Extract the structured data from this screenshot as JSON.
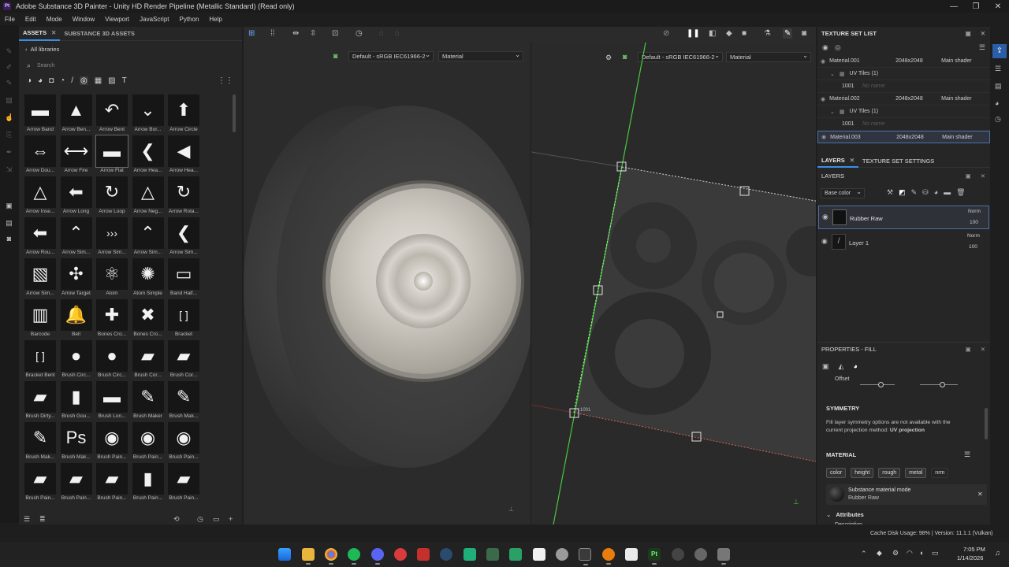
{
  "window": {
    "title": "Adobe Substance 3D Painter - Unity HD Render Pipeline (Metallic Standard) (Read only)",
    "logo_text": "Pt"
  },
  "menu": [
    "File",
    "Edit",
    "Mode",
    "Window",
    "Viewport",
    "JavaScript",
    "Python",
    "Help"
  ],
  "assets": {
    "tabs": [
      "ASSETS",
      "SUBSTANCE 3D ASSETS"
    ],
    "breadcrumb": "All libraries",
    "search_placeholder": "Search",
    "items": [
      "Arrow Band",
      "Arrow Ben...",
      "Arrow Bent",
      "Arrow Bor...",
      "Arrow Circle",
      "Arrow Dou...",
      "Arrow Fire",
      "Arrow Flat",
      "Arrow Hea...",
      "Arrow Hea...",
      "Arrow Inse...",
      "Arrow Long",
      "Arrow Loop",
      "Arrow Neg...",
      "Arrow Rota...",
      "Arrow Rou...",
      "Arrow Sim...",
      "Arrow Sim...",
      "Arrow Sim...",
      "Arrow Sim...",
      "Arrow Sim...",
      "Arrow Target",
      "Atom",
      "Atom Simple",
      "Band Half...",
      "Barcode",
      "Bell",
      "Bones Cro...",
      "Bones Cro...",
      "Bracket",
      "Bracket Bent",
      "Brush Circ...",
      "Brush Circ...",
      "Brush Cor...",
      "Brush Cor...",
      "Brush Dirty...",
      "Brush Gou...",
      "Brush Lon...",
      "Brush Maker",
      "Brush Mak...",
      "Brush Mak...",
      "Brush Mak...",
      "Brush Pain...",
      "Brush Pain...",
      "Brush Pain...",
      "Brush Pain...",
      "Brush Pain...",
      "Brush Pain...",
      "Brush Pain...",
      "Brush Pain..."
    ],
    "glyphs": [
      "▬",
      "▲",
      "↶",
      "⌄",
      "⬆",
      "⇔",
      "⟷",
      "▬",
      "❮",
      "◀",
      "△",
      "⬅",
      "↻",
      "△",
      "↻",
      "⬅",
      "⌃",
      "›››",
      "⌃",
      "❮",
      "▧",
      "✣",
      "⚛",
      "✺",
      "▭",
      "▥",
      "🔔",
      "✚",
      "✖",
      "[ ]",
      "[ ]",
      "●",
      "●",
      "▰",
      "▰",
      "▰",
      "▮",
      "▬",
      "✎",
      "✎",
      "✎",
      "Ps",
      "◉",
      "◉",
      "◉",
      "▰",
      "▰",
      "▰",
      "▮",
      "▰"
    ]
  },
  "viewport": {
    "left": {
      "colorspace": "Default - sRGB IEC61966-2",
      "channel": "Material"
    },
    "right": {
      "colorspace": "Default - sRGB IEC61966-2",
      "channel": "Material"
    },
    "uv_label": "1001"
  },
  "texture_set_list": {
    "title": "TEXTURE SET LIST",
    "sets": [
      {
        "name": "Material.001",
        "res": "2048x2048",
        "shader": "Main shader",
        "uv": "UV Tiles (1)",
        "tile": "1001",
        "material": "No name"
      },
      {
        "name": "Material.002",
        "res": "2048x2048",
        "shader": "Main shader",
        "uv": "UV Tiles (1)",
        "tile": "1001",
        "material": "No name"
      },
      {
        "name": "Material.003",
        "res": "2048x2048",
        "shader": "Main shader"
      }
    ]
  },
  "layers": {
    "tabs": [
      "LAYERS",
      "TEXTURE SET SETTINGS"
    ],
    "title": "LAYERS",
    "channel": "Base color",
    "items": [
      {
        "name": "Rubber Raw",
        "blend": "Norm",
        "opacity": "100"
      },
      {
        "name": "Layer 1",
        "blend": "Norm",
        "opacity": "100"
      }
    ]
  },
  "properties": {
    "title": "PROPERTIES - FILL",
    "offset_label": "Offset",
    "symmetry_title": "SYMMETRY",
    "symmetry_text_1": "Fill layer symmetry options are not available with the",
    "symmetry_text_2": "current projection method:",
    "symmetry_method": "UV projection",
    "material_title": "MATERIAL",
    "channels": [
      "color",
      "height",
      "rough",
      "metal",
      "nrm"
    ],
    "material_mode": "Substance material mode",
    "material_name": "Rubber Raw",
    "attributes": "Attributes",
    "description": "Description"
  },
  "status": {
    "cache": "Cache Disk Usage:  98% | Version: 11.1.1 (Vulkan)"
  },
  "taskbar": {
    "time": "7:05 PM",
    "date": "1/14/2026"
  }
}
